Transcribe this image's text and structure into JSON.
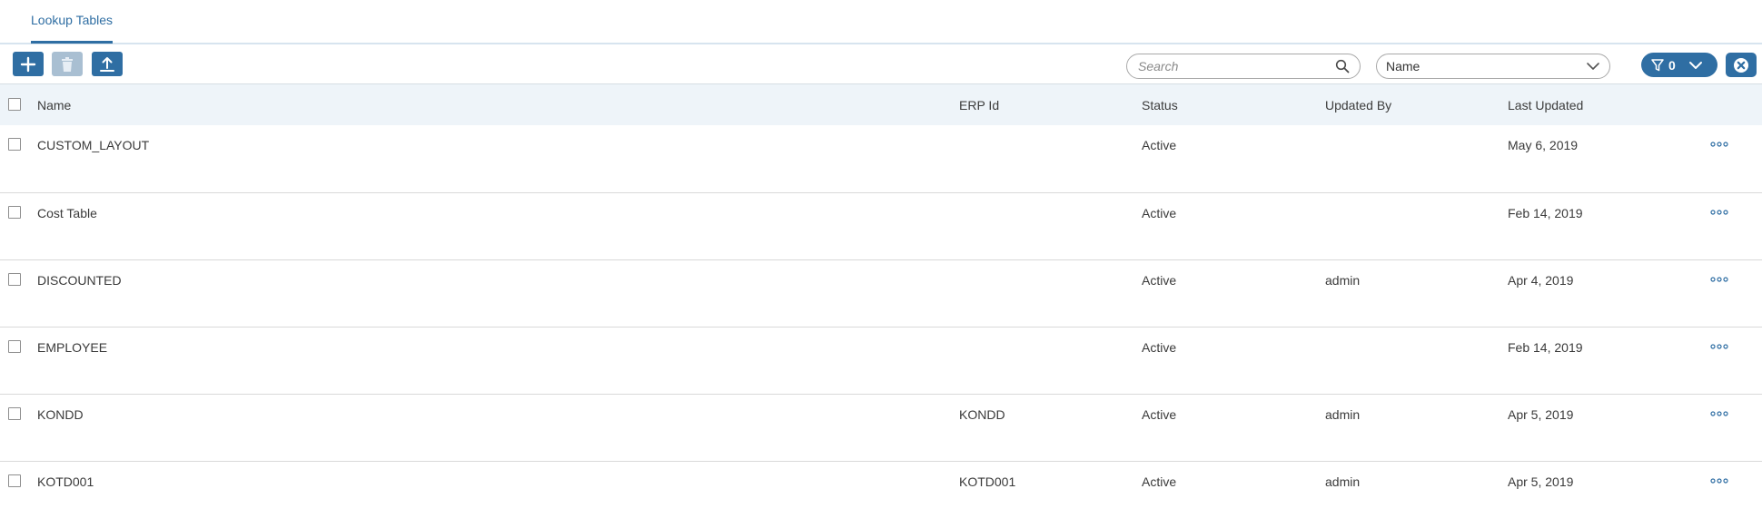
{
  "tabs": [
    {
      "label": "Lookup Tables"
    }
  ],
  "toolbar": {
    "add": "add-icon",
    "delete": "trash-icon",
    "upload": "upload-icon"
  },
  "search": {
    "placeholder": "Search",
    "icon": "search-icon"
  },
  "sort_select": {
    "value": "Name"
  },
  "filter": {
    "count": "0"
  },
  "colors": {
    "accent": "#2f6ea3",
    "header_bg": "#eef4f9",
    "border": "#d9d9d9"
  },
  "table": {
    "headers": {
      "name": "Name",
      "erp_id": "ERP Id",
      "status": "Status",
      "updated_by": "Updated By",
      "last_updated": "Last Updated"
    },
    "rows": [
      {
        "name": "CUSTOM_LAYOUT",
        "erp_id": "",
        "status": "Active",
        "updated_by": "",
        "last_updated": "May 6, 2019"
      },
      {
        "name": "Cost Table",
        "erp_id": "",
        "status": "Active",
        "updated_by": "",
        "last_updated": "Feb 14, 2019"
      },
      {
        "name": "DISCOUNTED",
        "erp_id": "",
        "status": "Active",
        "updated_by": "admin",
        "last_updated": "Apr 4, 2019"
      },
      {
        "name": "EMPLOYEE",
        "erp_id": "",
        "status": "Active",
        "updated_by": "",
        "last_updated": "Feb 14, 2019"
      },
      {
        "name": "KONDD",
        "erp_id": "KONDD",
        "status": "Active",
        "updated_by": "admin",
        "last_updated": "Apr 5, 2019"
      },
      {
        "name": "KOTD001",
        "erp_id": "KOTD001",
        "status": "Active",
        "updated_by": "admin",
        "last_updated": "Apr 5, 2019"
      }
    ]
  }
}
